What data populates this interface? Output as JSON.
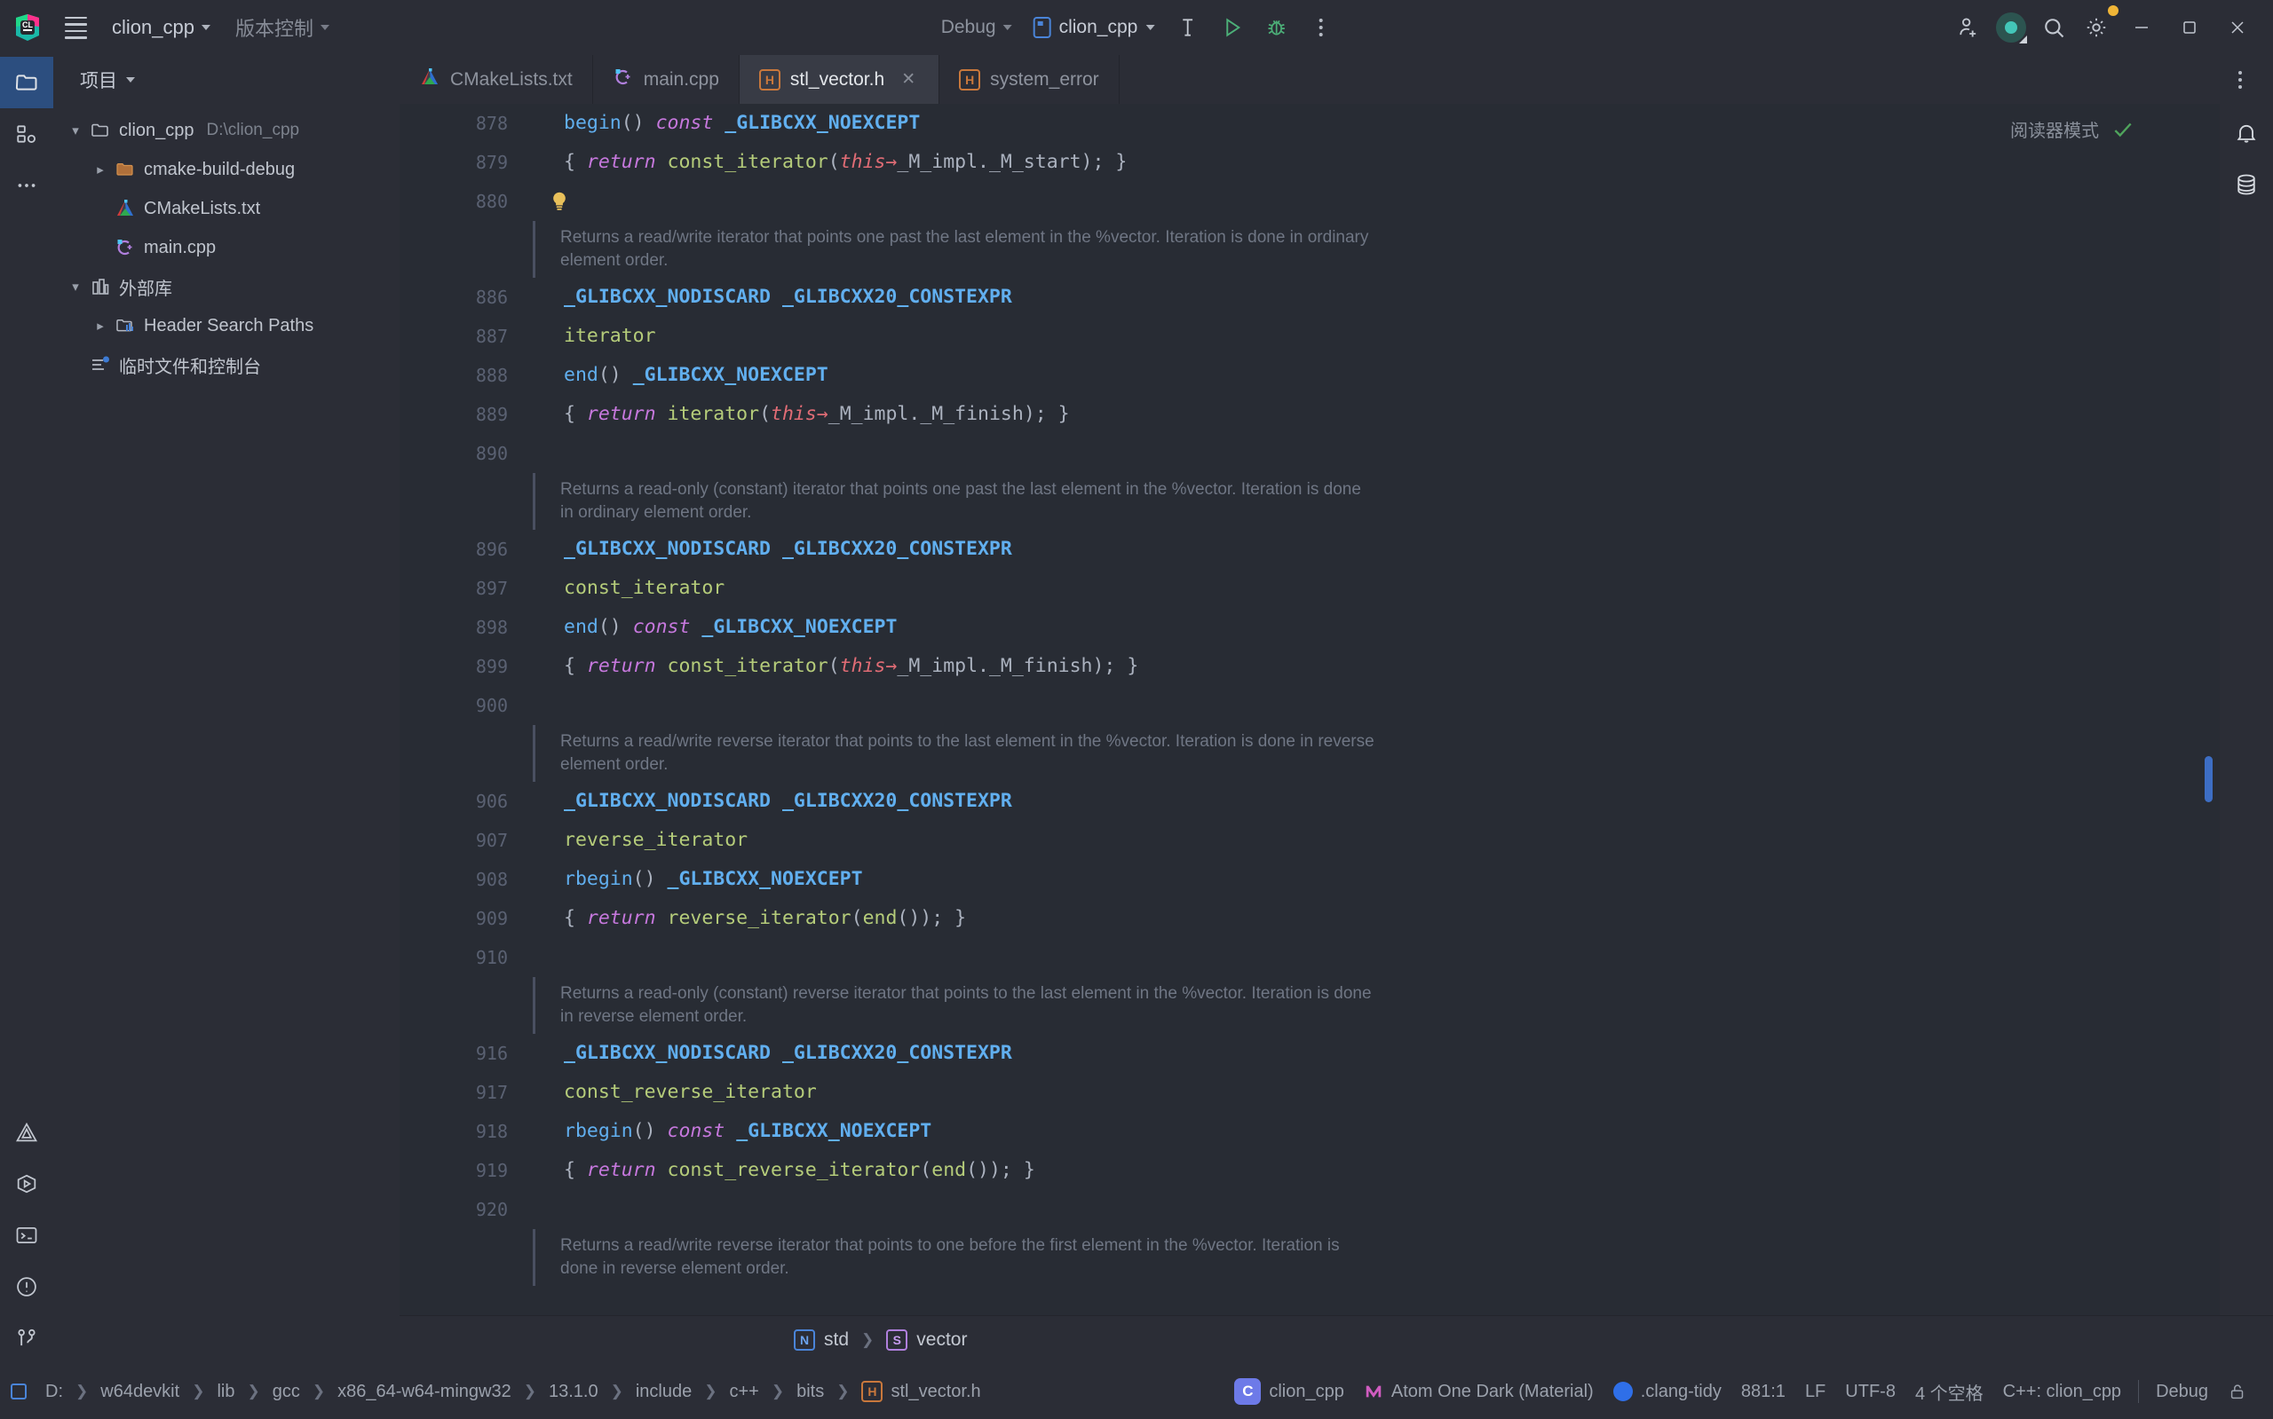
{
  "titlebar": {
    "menu_icon": "hamburger-icon",
    "project_name": "clion_cpp",
    "vcs_label": "版本控制",
    "run_config": "Debug",
    "target_name": "clion_cpp",
    "build_icon": "hammer-icon",
    "run_icon": "run-triangle-icon",
    "debug_icon": "bug-icon",
    "more_icon": "more-vertical-icon",
    "add_user_icon": "add-user-icon",
    "ai_icon": "ai-assistant-icon",
    "search_icon": "search-icon",
    "settings_icon": "gear-icon",
    "minimize_icon": "minimize-icon",
    "maximize_icon": "maximize-icon",
    "close_icon": "close-icon"
  },
  "rail": {
    "top_items": [
      {
        "name": "project-tool-window",
        "icon": "folder-icon",
        "active": true
      },
      {
        "name": "structure-tool-window",
        "icon": "structure-icon",
        "active": false
      },
      {
        "name": "more-tool-windows",
        "icon": "more-horizontal-icon",
        "active": false
      }
    ],
    "bottom_items": [
      {
        "name": "cmake-tool-window",
        "icon": "cmake-triangle-icon"
      },
      {
        "name": "run-tool-window",
        "icon": "run-hex-icon"
      },
      {
        "name": "terminal-tool-window",
        "icon": "terminal-icon"
      },
      {
        "name": "problems-tool-window",
        "icon": "warning-circle-icon"
      },
      {
        "name": "version-control-tool-window",
        "icon": "branch-icon"
      }
    ]
  },
  "project_panel": {
    "title": "项目",
    "tree": [
      {
        "depth": 0,
        "arrow": "down",
        "icon": "folder-icon",
        "label": "clion_cpp",
        "sub": "D:\\clion_cpp"
      },
      {
        "depth": 1,
        "arrow": "right",
        "icon": "folder-orange-icon",
        "label": "cmake-build-debug",
        "sub": ""
      },
      {
        "depth": 1,
        "arrow": "none",
        "icon": "cmake-icon",
        "label": "CMakeLists.txt",
        "sub": ""
      },
      {
        "depth": 1,
        "arrow": "none",
        "icon": "cpp-icon",
        "label": "main.cpp",
        "sub": ""
      },
      {
        "depth": 0,
        "arrow": "down",
        "icon": "library-icon",
        "label": "外部库",
        "sub": ""
      },
      {
        "depth": 1,
        "arrow": "right",
        "icon": "header-paths-icon",
        "label": "Header Search Paths",
        "sub": ""
      },
      {
        "depth": 0,
        "arrow": "none",
        "icon": "scratches-icon",
        "label": "临时文件和控制台",
        "sub": ""
      }
    ]
  },
  "tabs": {
    "items": [
      {
        "label": "CMakeLists.txt",
        "icon": "cmake-icon",
        "active": false,
        "closable": false
      },
      {
        "label": "main.cpp",
        "icon": "cpp-icon",
        "active": false,
        "closable": false
      },
      {
        "label": "stl_vector.h",
        "icon": "header-icon",
        "active": true,
        "closable": true
      },
      {
        "label": "system_error",
        "icon": "header-icon",
        "active": false,
        "closable": false
      }
    ],
    "overflow_icon": "more-vertical-icon"
  },
  "editor": {
    "reader_mode_label": "阅读器模式",
    "reader_mode_check": "check-icon",
    "bulb_icon": "lightbulb-icon",
    "lines": [
      {
        "num": "878",
        "type": "code",
        "tokens": [
          {
            "t": "begin",
            "c": "fn"
          },
          {
            "t": "() ",
            "c": "punct"
          },
          {
            "t": "const",
            "c": "kw"
          },
          {
            "t": " ",
            "c": "plain"
          },
          {
            "t": "_GLIBCXX_NOEXCEPT",
            "c": "macro"
          }
        ]
      },
      {
        "num": "879",
        "type": "code",
        "tokens": [
          {
            "t": "{ ",
            "c": "punct"
          },
          {
            "t": "return",
            "c": "kw"
          },
          {
            "t": " ",
            "c": "plain"
          },
          {
            "t": "const_iterator",
            "c": "type"
          },
          {
            "t": "(",
            "c": "punct"
          },
          {
            "t": "this",
            "c": "this"
          },
          {
            "t": "→",
            "c": "this"
          },
          {
            "t": "_M_impl._M_start",
            "c": "plain"
          },
          {
            "t": "); }",
            "c": "punct"
          }
        ]
      },
      {
        "num": "880",
        "type": "blank",
        "bulb": true,
        "tokens": []
      },
      {
        "num": "",
        "type": "doc",
        "text": "Returns a read/write iterator that points one past the last element in the %vector. Iteration is done in ordinary element order."
      },
      {
        "num": "886",
        "type": "code",
        "tokens": [
          {
            "t": "_GLIBCXX_NODISCARD _GLIBCXX20_CONSTEXPR",
            "c": "macro"
          }
        ]
      },
      {
        "num": "887",
        "type": "code",
        "tokens": [
          {
            "t": "iterator",
            "c": "type"
          }
        ]
      },
      {
        "num": "888",
        "type": "code",
        "tokens": [
          {
            "t": "end",
            "c": "fn"
          },
          {
            "t": "() ",
            "c": "punct"
          },
          {
            "t": "_GLIBCXX_NOEXCEPT",
            "c": "macro"
          }
        ]
      },
      {
        "num": "889",
        "type": "code",
        "tokens": [
          {
            "t": "{ ",
            "c": "punct"
          },
          {
            "t": "return",
            "c": "kw"
          },
          {
            "t": " ",
            "c": "plain"
          },
          {
            "t": "iterator",
            "c": "type"
          },
          {
            "t": "(",
            "c": "punct"
          },
          {
            "t": "this",
            "c": "this"
          },
          {
            "t": "→",
            "c": "this"
          },
          {
            "t": "_M_impl._M_finish",
            "c": "plain"
          },
          {
            "t": "); }",
            "c": "punct"
          }
        ]
      },
      {
        "num": "890",
        "type": "blank",
        "tokens": []
      },
      {
        "num": "",
        "type": "doc",
        "text": "Returns a read-only (constant) iterator that points one past the last element in the %vector. Iteration is done in ordinary element order."
      },
      {
        "num": "896",
        "type": "code",
        "tokens": [
          {
            "t": "_GLIBCXX_NODISCARD _GLIBCXX20_CONSTEXPR",
            "c": "macro"
          }
        ]
      },
      {
        "num": "897",
        "type": "code",
        "tokens": [
          {
            "t": "const_iterator",
            "c": "type"
          }
        ]
      },
      {
        "num": "898",
        "type": "code",
        "tokens": [
          {
            "t": "end",
            "c": "fn"
          },
          {
            "t": "() ",
            "c": "punct"
          },
          {
            "t": "const",
            "c": "kw"
          },
          {
            "t": " ",
            "c": "plain"
          },
          {
            "t": "_GLIBCXX_NOEXCEPT",
            "c": "macro"
          }
        ]
      },
      {
        "num": "899",
        "type": "code",
        "tokens": [
          {
            "t": "{ ",
            "c": "punct"
          },
          {
            "t": "return",
            "c": "kw"
          },
          {
            "t": " ",
            "c": "plain"
          },
          {
            "t": "const_iterator",
            "c": "type"
          },
          {
            "t": "(",
            "c": "punct"
          },
          {
            "t": "this",
            "c": "this"
          },
          {
            "t": "→",
            "c": "this"
          },
          {
            "t": "_M_impl._M_finish",
            "c": "plain"
          },
          {
            "t": "); }",
            "c": "punct"
          }
        ]
      },
      {
        "num": "900",
        "type": "blank",
        "tokens": []
      },
      {
        "num": "",
        "type": "doc",
        "text": "Returns a read/write reverse iterator that points to the last element in the %vector. Iteration is done in reverse element order."
      },
      {
        "num": "906",
        "type": "code",
        "tokens": [
          {
            "t": "_GLIBCXX_NODISCARD _GLIBCXX20_CONSTEXPR",
            "c": "macro"
          }
        ]
      },
      {
        "num": "907",
        "type": "code",
        "tokens": [
          {
            "t": "reverse_iterator",
            "c": "type"
          }
        ]
      },
      {
        "num": "908",
        "type": "code",
        "tokens": [
          {
            "t": "rbegin",
            "c": "fn"
          },
          {
            "t": "() ",
            "c": "punct"
          },
          {
            "t": "_GLIBCXX_NOEXCEPT",
            "c": "macro"
          }
        ]
      },
      {
        "num": "909",
        "type": "code",
        "tokens": [
          {
            "t": "{ ",
            "c": "punct"
          },
          {
            "t": "return",
            "c": "kw"
          },
          {
            "t": " ",
            "c": "plain"
          },
          {
            "t": "reverse_iterator",
            "c": "type"
          },
          {
            "t": "(",
            "c": "punct"
          },
          {
            "t": "end",
            "c": "type"
          },
          {
            "t": "()); }",
            "c": "punct"
          }
        ]
      },
      {
        "num": "910",
        "type": "blank",
        "tokens": []
      },
      {
        "num": "",
        "type": "doc",
        "text": "Returns a read-only (constant) reverse iterator that points to the last element in the %vector. Iteration is done in reverse element order."
      },
      {
        "num": "916",
        "type": "code",
        "tokens": [
          {
            "t": "_GLIBCXX_NODISCARD _GLIBCXX20_CONSTEXPR",
            "c": "macro"
          }
        ]
      },
      {
        "num": "917",
        "type": "code",
        "tokens": [
          {
            "t": "const_reverse_iterator",
            "c": "type"
          }
        ]
      },
      {
        "num": "918",
        "type": "code",
        "tokens": [
          {
            "t": "rbegin",
            "c": "fn"
          },
          {
            "t": "() ",
            "c": "punct"
          },
          {
            "t": "const",
            "c": "kw"
          },
          {
            "t": " ",
            "c": "plain"
          },
          {
            "t": "_GLIBCXX_NOEXCEPT",
            "c": "macro"
          }
        ]
      },
      {
        "num": "919",
        "type": "code",
        "tokens": [
          {
            "t": "{ ",
            "c": "punct"
          },
          {
            "t": "return",
            "c": "kw"
          },
          {
            "t": " ",
            "c": "plain"
          },
          {
            "t": "const_reverse_iterator",
            "c": "type"
          },
          {
            "t": "(",
            "c": "punct"
          },
          {
            "t": "end",
            "c": "type"
          },
          {
            "t": "()); }",
            "c": "punct"
          }
        ]
      },
      {
        "num": "920",
        "type": "blank",
        "tokens": []
      },
      {
        "num": "",
        "type": "doc",
        "text": "Returns a read/write reverse iterator that points to one before the first element in the %vector. Iteration is done in reverse element order."
      }
    ]
  },
  "breadcrumb": {
    "items": [
      {
        "label": "std",
        "badge": "N",
        "badge_kind": "n"
      },
      {
        "label": "vector",
        "badge": "S",
        "badge_kind": "s"
      }
    ]
  },
  "statusbar": {
    "path": [
      "D:",
      "w64devkit",
      "lib",
      "gcc",
      "x86_64-w64-mingw32",
      "13.1.0",
      "include",
      "c++",
      "bits"
    ],
    "file": "stl_vector.h",
    "project_badge": "C",
    "project_name": "clion_cpp",
    "theme": "Atom One Dark (Material)",
    "inspection": ".clang-tidy",
    "caret": "881:1",
    "line_sep": "LF",
    "encoding": "UTF-8",
    "indent": "4 个空格",
    "language_scope": "C++: clion_cpp",
    "build_config": "Debug",
    "lock_icon": "unlocked-icon"
  },
  "rightrail": {
    "items": [
      {
        "name": "notifications-tool-window",
        "icon": "bell-icon"
      },
      {
        "name": "database-tool-window",
        "icon": "database-icon"
      }
    ]
  }
}
